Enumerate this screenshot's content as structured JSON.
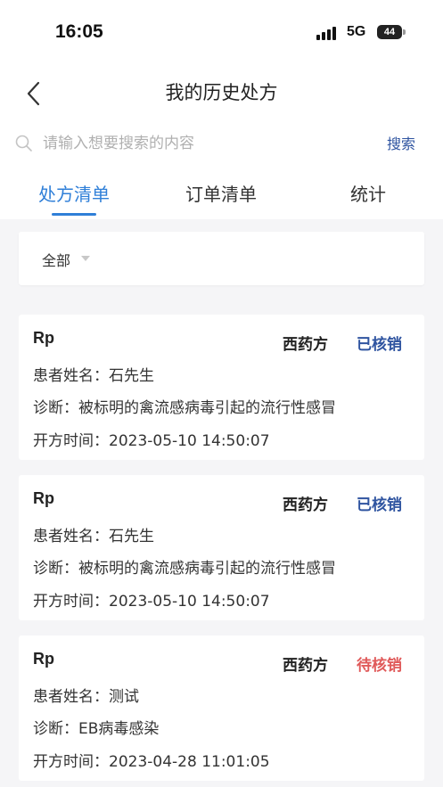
{
  "status_bar": {
    "time": "16:05",
    "network": "5G",
    "battery": "44"
  },
  "nav": {
    "title": "我的历史处方"
  },
  "search": {
    "placeholder": "请输入想要搜索的内容",
    "button_label": "搜索"
  },
  "tabs": [
    {
      "label": "处方清单",
      "active": true
    },
    {
      "label": "订单清单",
      "active": false
    },
    {
      "label": "统计",
      "active": false
    }
  ],
  "filter": {
    "selected": "全部"
  },
  "colors": {
    "accent": "#2f7fd8",
    "done_status": "#2f54a0",
    "pending_status": "#e05a5a"
  },
  "prescriptions": [
    {
      "rp": "Rp",
      "type": "西药方",
      "status": "已核销",
      "patient": "患者姓名：石先生",
      "diagnosis": "诊断：被标明的禽流感病毒引起的流行性感冒",
      "time": "开方时间：2023-05-10 14:50:07"
    },
    {
      "rp": "Rp",
      "type": "西药方",
      "status": "已核销",
      "patient": "患者姓名：石先生",
      "diagnosis": "诊断：被标明的禽流感病毒引起的流行性感冒",
      "time": "开方时间：2023-05-10 14:50:07"
    },
    {
      "rp": "Rp",
      "type": "西药方",
      "status": "待核销",
      "patient": "患者姓名：测试",
      "diagnosis": "诊断：EB病毒感染",
      "time": "开方时间：2023-04-28 11:01:05"
    }
  ]
}
